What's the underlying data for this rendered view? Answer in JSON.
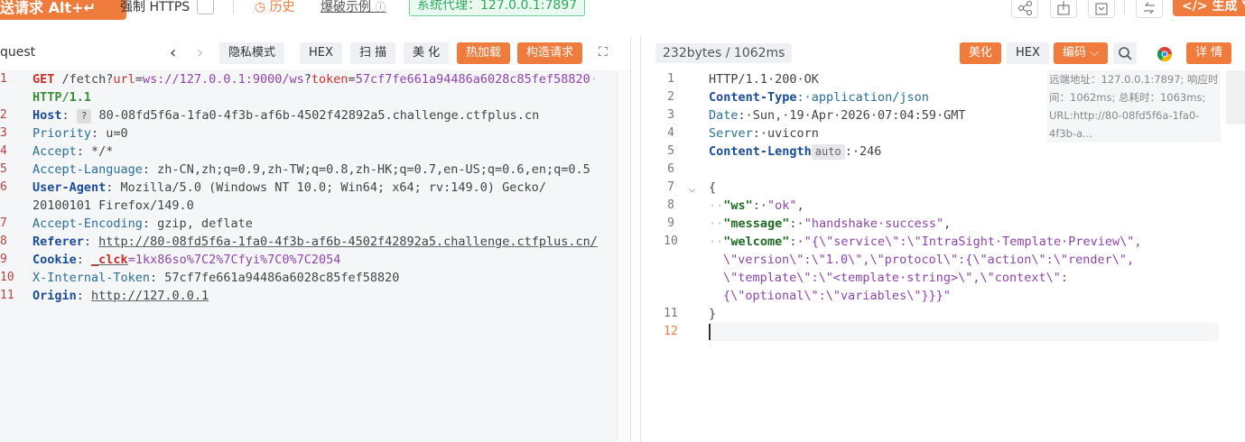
{
  "top": {
    "send_label": "送请求 Alt+↵",
    "force_https": "强制 HTTPS",
    "history": "历史",
    "brute_example": "爆破示例",
    "proxy": "系统代理：127.0.0.1:7897",
    "generate": "</> 生成 Y"
  },
  "left": {
    "title": "quest",
    "buttons": {
      "privacy": "隐私模式",
      "hex": "HEX",
      "scan": "扫 描",
      "beautify": "美 化",
      "hot_load": "热加载",
      "build_request": "构造请求"
    },
    "line_numbers": [
      "1",
      "",
      "2",
      "3",
      "4",
      "5",
      "6",
      "",
      "7",
      "8",
      "9",
      "10",
      "11"
    ],
    "lines": {
      "l1_method": "GET",
      "l1_path": " /fetch?",
      "l1_p1k": "url",
      "l1_eq1": "=",
      "l1_p1v": "ws://127.0.0.1:9000/ws",
      "l1_q": "?",
      "l1_p2k": "token",
      "l1_eq2": "=",
      "l1_p2v": "57cf7fe661a94486a6028c85fef58820",
      "l1_tail": "·",
      "l1b": "HTTP/1.1",
      "host_k": "Host",
      "host_q": "?",
      "host_v": " 80-08fd5f6a-1fa0-4f3b-af6b-4502f42892a5.challenge.ctfplus.cn",
      "prio_k": "Priority",
      "prio_v": ": u=0",
      "accept_k": "Accept",
      "accept_v": ": */*",
      "al_k": "Accept-Language",
      "al_v": ": zh-CN,zh;q=0.9,zh-TW;q=0.8,zh-HK;q=0.7,en-US;q=0.6,en;q=0.5",
      "ua_k": "User-Agent",
      "ua_v": ": Mozilla/5.0 (Windows NT 10.0; Win64; x64; rv:149.0) Gecko/",
      "ua_v2": "20100101 Firefox/149.0",
      "ae_k": "Accept-Encoding",
      "ae_v": ": gzip, deflate",
      "ref_k": "Referer",
      "ref_sep": ": ",
      "ref_v": "http://80-08fd5f6a-1fa0-4f3b-af6b-4502f42892a5.challenge.ctfplus.cn/",
      "cookie_k": "Cookie",
      "cookie_sep": ": ",
      "cookie_n": "_clck",
      "cookie_v": "=1kx86so%7C2%7Cfyi%7C0%7C2054",
      "xit_k": "X-Internal-Token",
      "xit_v": ": 57cf7fe661a94486a6028c85fef58820",
      "origin_k": "Origin",
      "origin_sep": ": ",
      "origin_v": "http://127.0.0.1"
    }
  },
  "right": {
    "stat": "232bytes / 1062ms",
    "buttons": {
      "beautify": "美化",
      "hex": "HEX",
      "encoding": "编码 ⌵",
      "detail": "详 情"
    },
    "meta": "远端地址：127.0.0.1:7897; 响应时间：1062ms; 总耗时：1063ms; URL:http://80-08fd5f6a-1fa0-4f3b-a...",
    "line_numbers": [
      "1",
      "2",
      "3",
      "4",
      "5",
      "6",
      "7",
      "8",
      "9",
      "10",
      "",
      "",
      "",
      "11",
      "12"
    ],
    "lines": {
      "r1": "HTTP/1.1·200·OK",
      "r2k": "Content-Type",
      "r2v": ":·application/json",
      "r3k": "Date",
      "r3v": ":·Sun,·19·Apr·2026·07:04:59·GMT",
      "r4k": "Server",
      "r4v": ":·uvicorn",
      "r5k": "Content-Length",
      "r5badge": "auto",
      "r5v": ":·246",
      "r7": "{",
      "r8k": "\"ws\"",
      "r8v": "\"ok\"",
      "r9k": "\"message\"",
      "r9v": "\"handshake·success\"",
      "r10k": "\"welcome\"",
      "r10v1": "\"{\\\"service\\\":\\\"IntraSight·Template·Preview\\\",",
      "r10v2": "\\\"version\\\":\\\"1.0\\\",\\\"protocol\\\":{\\\"action\\\":\\\"render\\\",",
      "r10v3": "\\\"template\\\":\\\"<template·string>\\\",\\\"context\\\":",
      "r10v4": "{\\\"optional\\\":\\\"variables\\\"}}}\"",
      "r11": "}"
    }
  },
  "colors": {
    "accent": "#ef7b3c",
    "proxy_green": "#2eaa5f"
  }
}
